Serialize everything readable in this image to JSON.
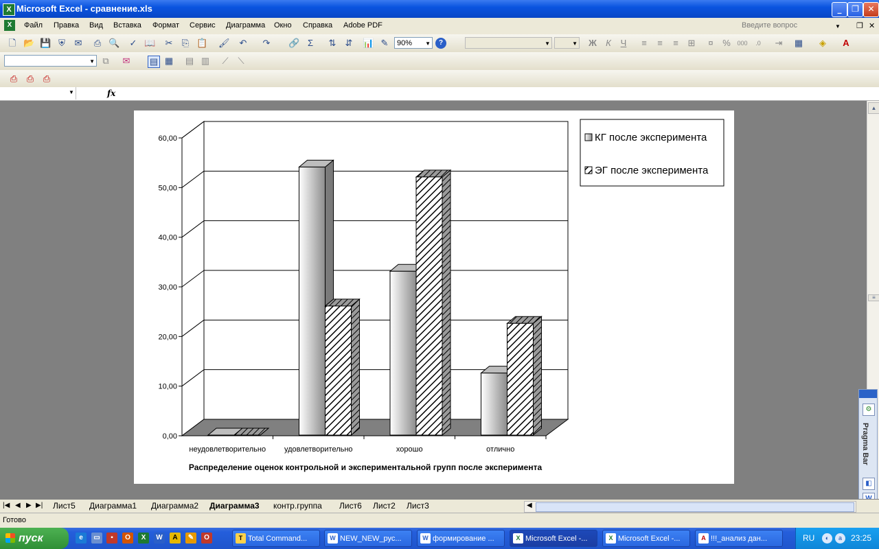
{
  "window": {
    "title": "Microsoft Excel - сравнение.xls"
  },
  "menu": {
    "items": [
      "Файл",
      "Правка",
      "Вид",
      "Вставка",
      "Формат",
      "Сервис",
      "Диаграмма",
      "Окно",
      "Справка",
      "Adobe PDF"
    ],
    "ask_placeholder": "Введите вопрос"
  },
  "toolbar": {
    "zoom": "90%"
  },
  "formula_bar": {
    "fx": "fx"
  },
  "chart_data": {
    "type": "bar",
    "title": "Распределение оценок контрольной и экспериментальной групп после эксперимента",
    "categories": [
      "неудовлетворительно",
      "удовлетворительно",
      "хорошо",
      "отлично"
    ],
    "series": [
      {
        "name": "КГ после эксперимента",
        "values": [
          0,
          54,
          33,
          12.5
        ]
      },
      {
        "name": "ЭГ после эксперимента",
        "values": [
          0,
          26,
          52,
          22.5
        ]
      }
    ],
    "ylim": [
      0,
      60
    ],
    "yticks": [
      "0,00",
      "10,00",
      "20,00",
      "30,00",
      "40,00",
      "50,00",
      "60,00"
    ],
    "grid": true,
    "legend_position": "right",
    "colors": {
      "kg": "#c8c8c8",
      "eg_hatch": "#000000",
      "floor": "#808080"
    }
  },
  "sheets": {
    "tabs": [
      "Лист5",
      "Диаграмма1",
      "Диаграмма2",
      "Диаграмма3",
      "контр.группа",
      "Лист6",
      "Лист2",
      "Лист3"
    ],
    "active": "Диаграмма3"
  },
  "status": {
    "text": "Готово"
  },
  "pragma": {
    "label": "Pragma Bar"
  },
  "taskbar": {
    "start": "пуск",
    "tasks": [
      "Total Command...",
      "NEW_NEW_рус...",
      "формирование ...",
      "Microsoft Excel -...",
      "Microsoft Excel -...",
      "!!!_анализ дан..."
    ],
    "lang": "RU",
    "clock": "23:25"
  }
}
